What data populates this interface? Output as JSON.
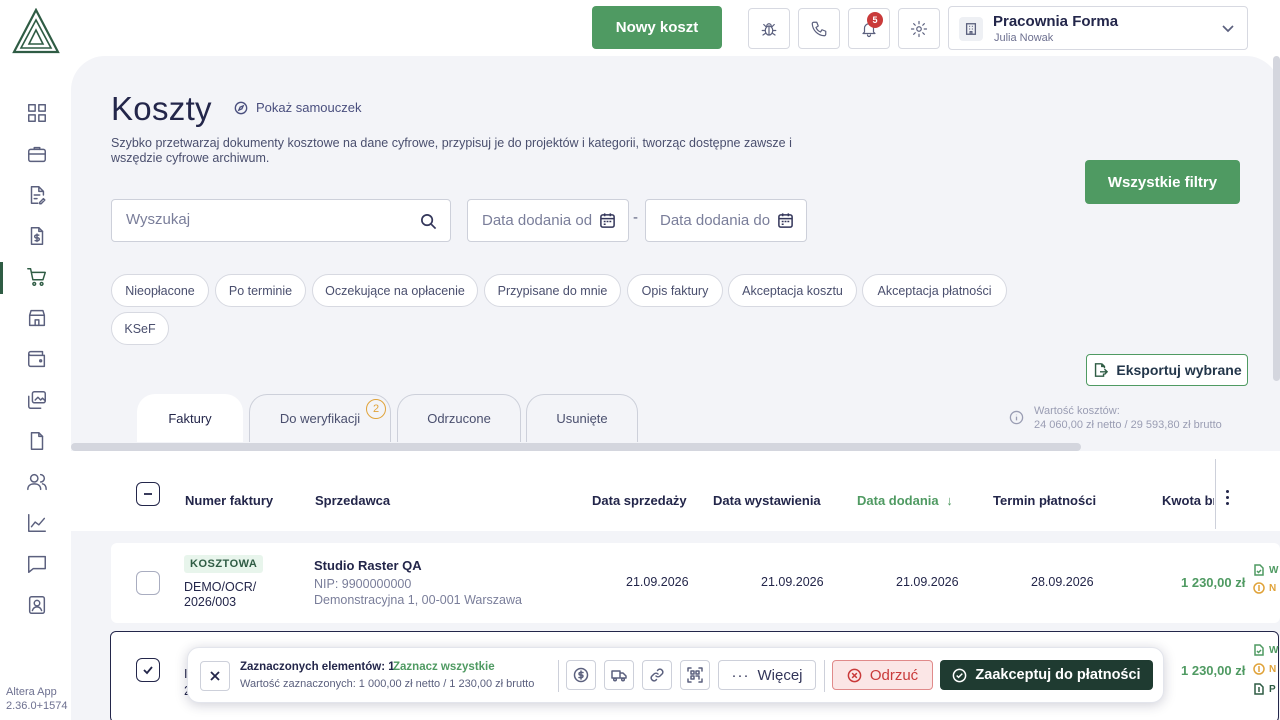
{
  "app": {
    "version_label": "Altera App",
    "version_number": "2.36.0+1574"
  },
  "colors": {
    "accent": "#4f9a62",
    "dark_accent": "#1f3b31",
    "danger": "#c93a3a",
    "warning": "#e0a33a",
    "text": "#23264a"
  },
  "sidebar": {
    "items": [
      {
        "icon": "dashboard-grid-icon"
      },
      {
        "icon": "briefcase-icon"
      },
      {
        "icon": "document-edit-icon"
      },
      {
        "icon": "invoice-dollar-icon"
      },
      {
        "icon": "shopping-cart-icon",
        "active": true
      },
      {
        "icon": "store-icon"
      },
      {
        "icon": "wallet-icon"
      },
      {
        "icon": "images-icon"
      },
      {
        "icon": "file-icon"
      },
      {
        "icon": "users-icon"
      },
      {
        "icon": "chart-line-icon"
      },
      {
        "icon": "chat-icon"
      },
      {
        "icon": "user-badge-icon"
      }
    ]
  },
  "topbar": {
    "new_cost_label": "Nowy koszt",
    "notifications_count": "5",
    "company_name": "Pracownia Forma",
    "user_name": "Julia Nowak"
  },
  "page": {
    "title": "Koszty",
    "tutorial_label": "Pokaż samouczek",
    "description": "Szybko przetwarzaj dokumenty kosztowe na dane cyfrowe, przypisuj je do projektów i kategorii, tworząc dostępne zawsze i wszędzie cyfrowe archiwum."
  },
  "filters": {
    "search_placeholder": "Wyszukaj",
    "date_from_placeholder": "Data dodania od",
    "date_to_placeholder": "Data dodania do",
    "date_separator": "-",
    "all_filters_label": "Wszystkie filtry",
    "chips": [
      "Nieopłacone",
      "Po terminie",
      "Oczekujące na opłacenie",
      "Przypisane do mnie",
      "Opis faktury",
      "Akceptacja kosztu",
      "Akceptacja płatności",
      "KSeF"
    ]
  },
  "export_label": "Eksportuj wybrane",
  "tabs": [
    {
      "label": "Faktury",
      "active": true
    },
    {
      "label": "Do weryfikacji",
      "badge": "2"
    },
    {
      "label": "Odrzucone"
    },
    {
      "label": "Usunięte"
    }
  ],
  "costs_summary": {
    "label": "Wartość kosztów:",
    "value": "24 060,00 zł netto / 29 593,80 zł brutto"
  },
  "table": {
    "columns": {
      "invoice_number": "Numer faktury",
      "seller": "Sprzedawca",
      "sale_date": "Data sprzedaży",
      "issue_date": "Data wystawienia",
      "added_date": "Data dodania",
      "due_date": "Termin płatności",
      "gross_amount": "Kwota br"
    },
    "rows": [
      {
        "badge": "KOSZTOWA",
        "invoice_number": "DEMO/OCR/ 2026/003",
        "seller_name": "Studio Raster QA",
        "seller_nip": "NIP: 9900000000",
        "seller_address": "Demonstracyjna 1, 00-001 Warszawa",
        "sale_date": "21.09.2026",
        "issue_date": "21.09.2026",
        "added_date": "21.09.2026",
        "due_date": "28.09.2026",
        "amount": "1 230,00 zł",
        "status_1": "W",
        "status_2": "N"
      },
      {
        "invoice_number_short": "I",
        "invoice_number_short2": "2",
        "amount": "1 230,00 zł",
        "status_1": "W",
        "status_2": "N",
        "status_3": "P"
      }
    ]
  },
  "selection_bar": {
    "count_label": "Zaznaczonych elementów: 1",
    "select_all_label": "Zaznacz wszystkie",
    "value_label": "Wartość zaznaczonych: 1 000,00 zł netto / 1 230,00 zł brutto",
    "more_label": "Więcej",
    "reject_label": "Odrzuć",
    "accept_label": "Zaakceptuj do płatności"
  }
}
